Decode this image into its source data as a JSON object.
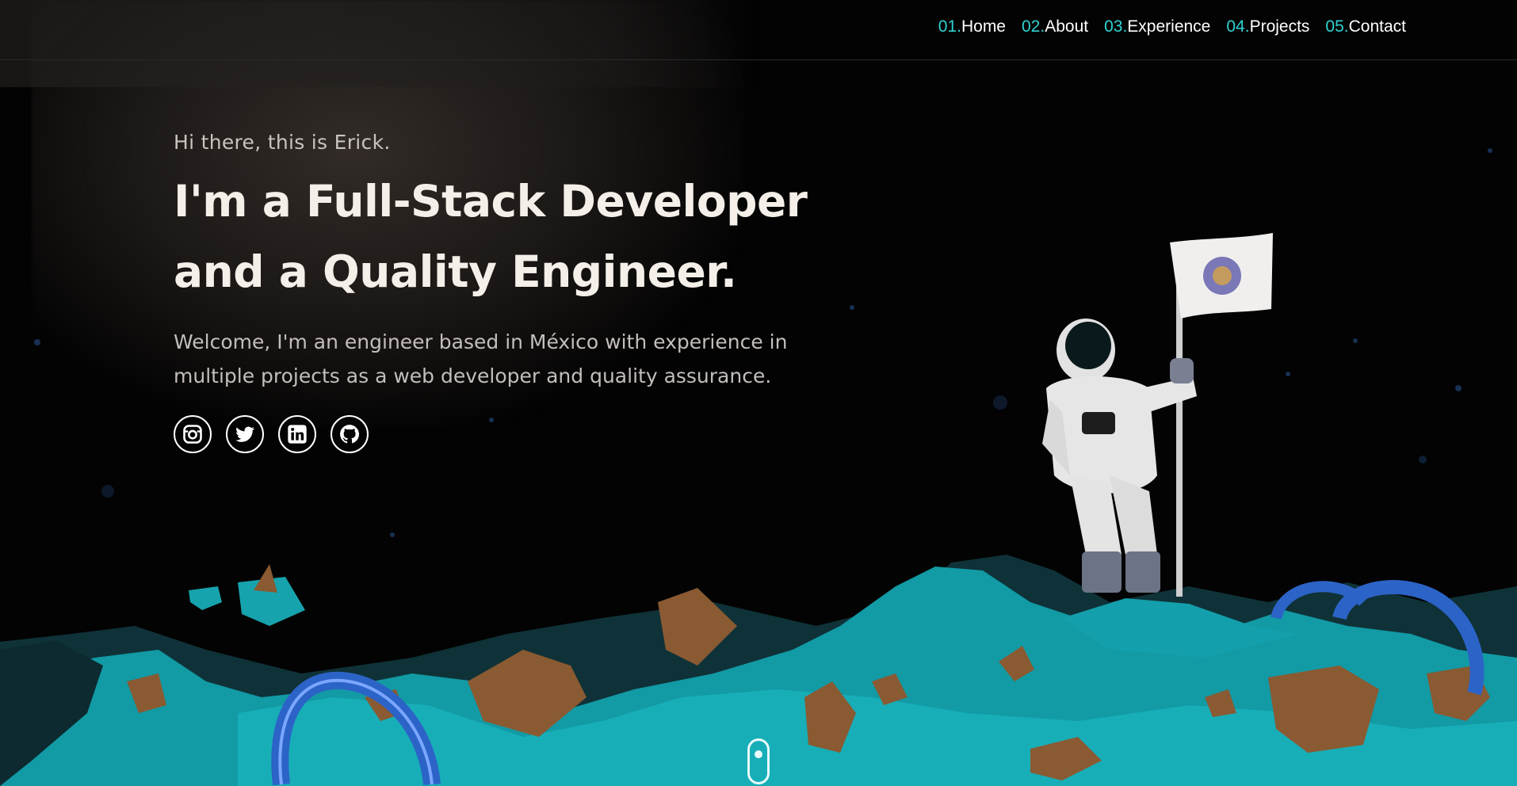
{
  "nav": {
    "items": [
      {
        "num": "01.",
        "label": "Home"
      },
      {
        "num": "02.",
        "label": "About"
      },
      {
        "num": "03.",
        "label": "Experience"
      },
      {
        "num": "04.",
        "label": "Projects"
      },
      {
        "num": "05.",
        "label": "Contact"
      }
    ]
  },
  "hero": {
    "greeting": "Hi there, this is Erick.",
    "headline_line1": "I'm a Full-Stack Developer",
    "headline_line2": "and a Quality Engineer.",
    "welcome": "Welcome, I'm an engineer based in México with experience in multiple projects as a web developer and quality assurance."
  },
  "socials": [
    {
      "icon": "instagram-icon"
    },
    {
      "icon": "twitter-icon"
    },
    {
      "icon": "linkedin-icon"
    },
    {
      "icon": "github-icon"
    }
  ],
  "colors": {
    "accent": "#2fd3d3",
    "headline": "#f4efe8",
    "terrain_teal": "#17a3ad",
    "rock_brown": "#8a5a32"
  }
}
